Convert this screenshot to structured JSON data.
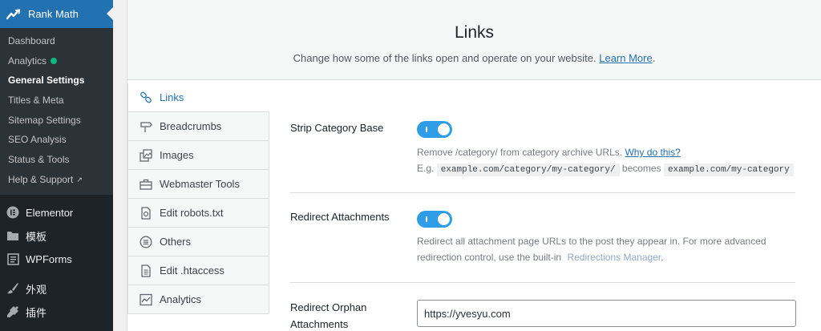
{
  "sidebar": {
    "plugin_title": "Rank Math",
    "submenu": [
      {
        "label": "Dashboard"
      },
      {
        "label": "Analytics"
      },
      {
        "label": "General Settings"
      },
      {
        "label": "Titles & Meta"
      },
      {
        "label": "Sitemap Settings"
      },
      {
        "label": "SEO Analysis"
      },
      {
        "label": "Status & Tools"
      },
      {
        "label": "Help & Support"
      }
    ],
    "menu": [
      {
        "label": "Elementor",
        "icon": "elementor-icon"
      },
      {
        "label": "模板",
        "icon": "folder-icon"
      },
      {
        "label": "WPForms",
        "icon": "wpforms-icon"
      },
      {
        "label": "外观",
        "icon": "paintbrush-icon"
      },
      {
        "label": "插件",
        "icon": "plugin-icon"
      }
    ]
  },
  "header": {
    "title": "Links",
    "subtitle": "Change how some of the links open and operate on your website.",
    "learn_more": "Learn More",
    "period": "."
  },
  "tabs": [
    {
      "label": "Links",
      "icon": "link-icon",
      "active": true
    },
    {
      "label": "Breadcrumbs",
      "icon": "signpost-icon"
    },
    {
      "label": "Images",
      "icon": "images-icon"
    },
    {
      "label": "Webmaster Tools",
      "icon": "toolbox-icon"
    },
    {
      "label": "Edit robots.txt",
      "icon": "robots-file-icon"
    },
    {
      "label": "Others",
      "icon": "list-circle-icon"
    },
    {
      "label": "Edit .htaccess",
      "icon": "file-text-icon"
    },
    {
      "label": "Analytics",
      "icon": "chart-line-icon"
    }
  ],
  "fields": {
    "strip_category": {
      "label": "Strip Category Base",
      "enabled": true,
      "desc": "Remove /category/ from category archive URLs.",
      "why_link": "Why do this?",
      "eg": "E.g.",
      "code1": "example.com/category/my-category/",
      "becomes": "becomes",
      "code2": "example.com/my-category"
    },
    "redirect_attachments": {
      "label": "Redirect Attachments",
      "enabled": true,
      "desc_line1": "Redirect all attachment page URLs to the post they appear in. For more advanced",
      "desc_line2": "redirection control, use the built-in",
      "manager_link": "Redirections Manager",
      "period": "."
    },
    "redirect_orphan": {
      "label": "Redirect Orphan Attachments",
      "value": "https://yvesyu.com"
    }
  },
  "colors": {
    "accent": "#2271b1",
    "toggle_on": "#2e9ce6",
    "sidebar_bg": "#1d2327",
    "status_dot": "#10b981"
  }
}
